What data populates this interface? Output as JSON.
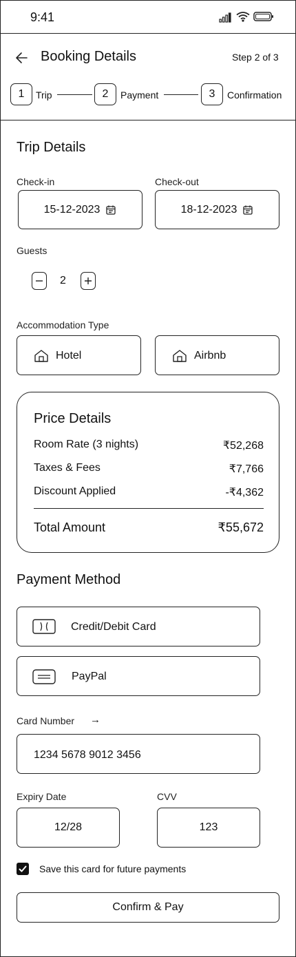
{
  "status_bar": {
    "time": "9:41"
  },
  "header": {
    "title": "Booking Details",
    "step_text": "Step 2 of 3"
  },
  "steps": [
    {
      "number": "1",
      "label": "Trip"
    },
    {
      "number": "2",
      "label": "Payment"
    },
    {
      "number": "3",
      "label": "Confirmation"
    }
  ],
  "trip": {
    "section_title": "Trip Details",
    "checkin_label": "Check-in",
    "checkin_value": "15-12-2023",
    "checkout_label": "Check-out",
    "checkout_value": "18-12-2023",
    "guests_label": "Guests",
    "guests_value": "2",
    "accommodation_label": "Accommodation Type",
    "accommodation_options": [
      "Hotel",
      "Airbnb"
    ]
  },
  "price": {
    "title": "Price Details",
    "rows": [
      {
        "label": "Room Rate (3 nights)",
        "value": "₹52,268"
      },
      {
        "label": "Taxes & Fees",
        "value": "₹7,766"
      },
      {
        "label": "Discount Applied",
        "value": "-₹4,362"
      }
    ],
    "total_label": "Total Amount",
    "total_value": "₹55,672"
  },
  "payment": {
    "section_title": "Payment Method",
    "methods": [
      "Credit/Debit Card",
      "PayPal"
    ],
    "card_number_label": "Card Number",
    "card_number_arrow": "→",
    "card_number_value": "1234 5678 9012 3456",
    "expiry_label": "Expiry Date",
    "expiry_value": "12/28",
    "cvv_label": "CVV",
    "cvv_value": "123",
    "save_card_label": "Save this card for future payments",
    "save_card_checked": true,
    "confirm_label": "Confirm & Pay"
  },
  "icons": {
    "back": "arrow-left-icon",
    "calendar": "calendar-icon",
    "home": "home-icon",
    "card": "card-icon",
    "wallet": "wallet-icon",
    "signal": "signal-icon",
    "wifi": "wifi-icon",
    "battery": "battery-icon",
    "check": "check-icon"
  }
}
